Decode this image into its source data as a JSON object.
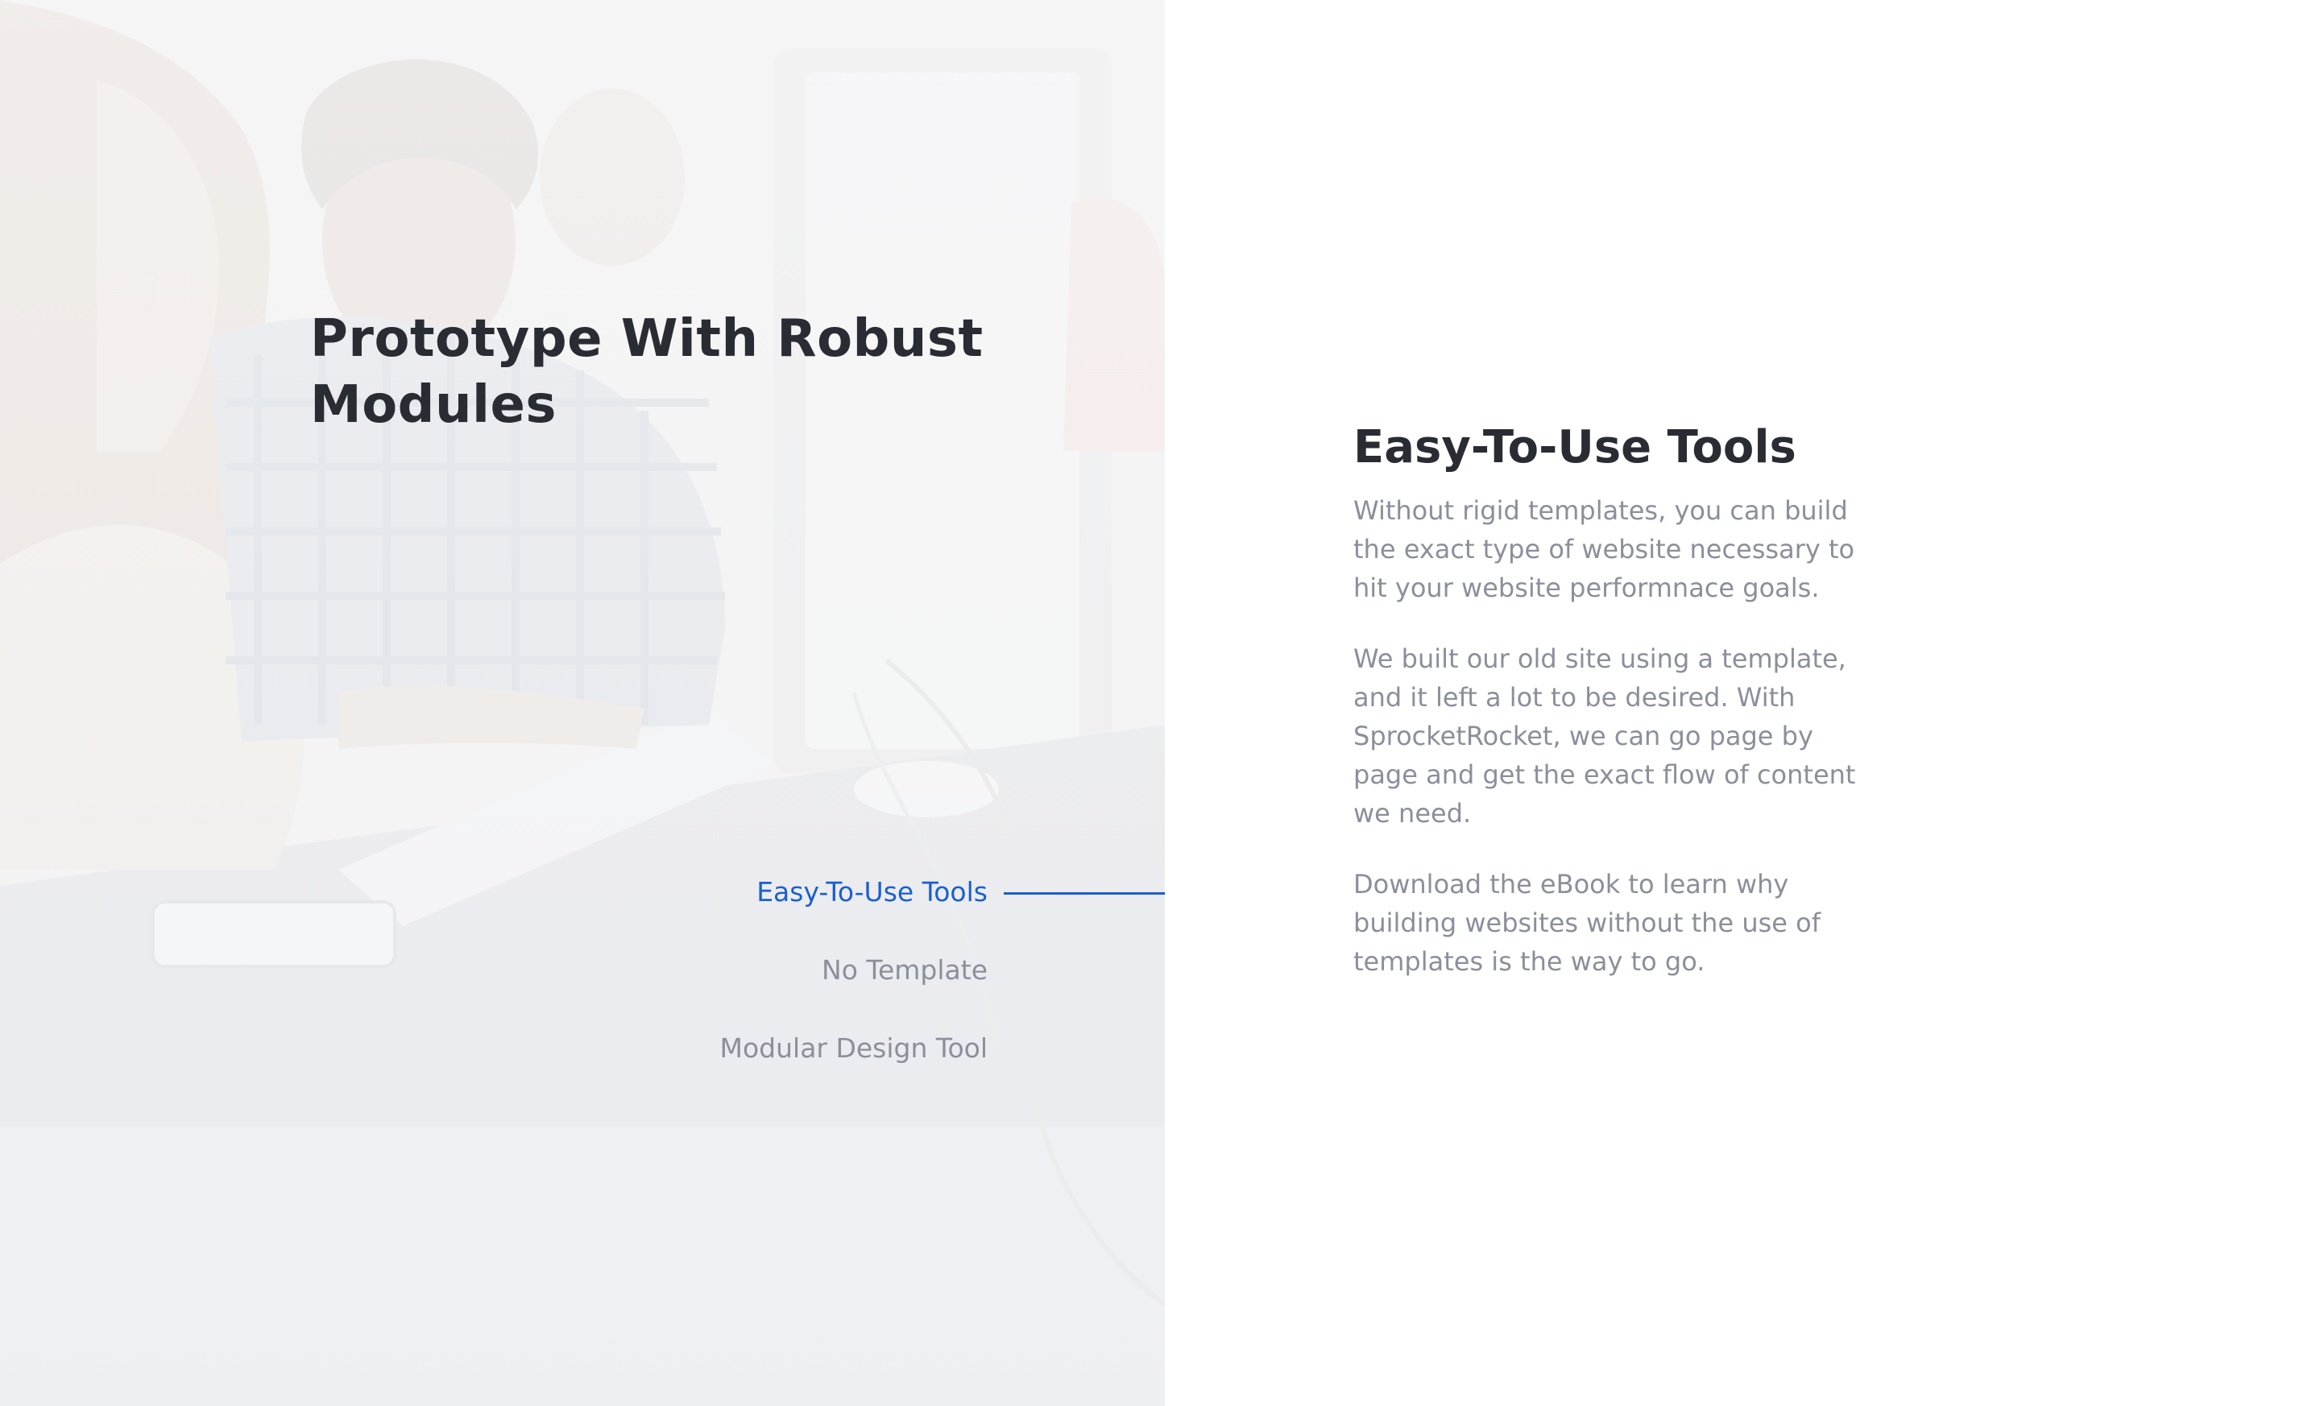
{
  "left": {
    "title": "Prototype With Robust Modules",
    "tabs": [
      {
        "label": "Easy-To-Use Tools",
        "active": true
      },
      {
        "label": "No Template",
        "active": false
      },
      {
        "label": "Modular Design Tool",
        "active": false
      }
    ]
  },
  "right": {
    "title": "Easy-To-Use Tools",
    "paragraphs": [
      "Without rigid templates, you can build the exact type of website necessary to hit your website performnace goals.",
      "We built our old site using a template, and it left a lot to be desired. With SprocketRocket, we can go page by page and get the exact flow of content we need.",
      "Download the eBook to learn why building websites without the use of templates is the way to go."
    ]
  },
  "colors": {
    "accent": "#1a5fd0",
    "heading": "#2a2c34",
    "body_text": "#8b8f9b",
    "panel_bg": "#eef0f3",
    "page_bg": "#ffffff"
  }
}
